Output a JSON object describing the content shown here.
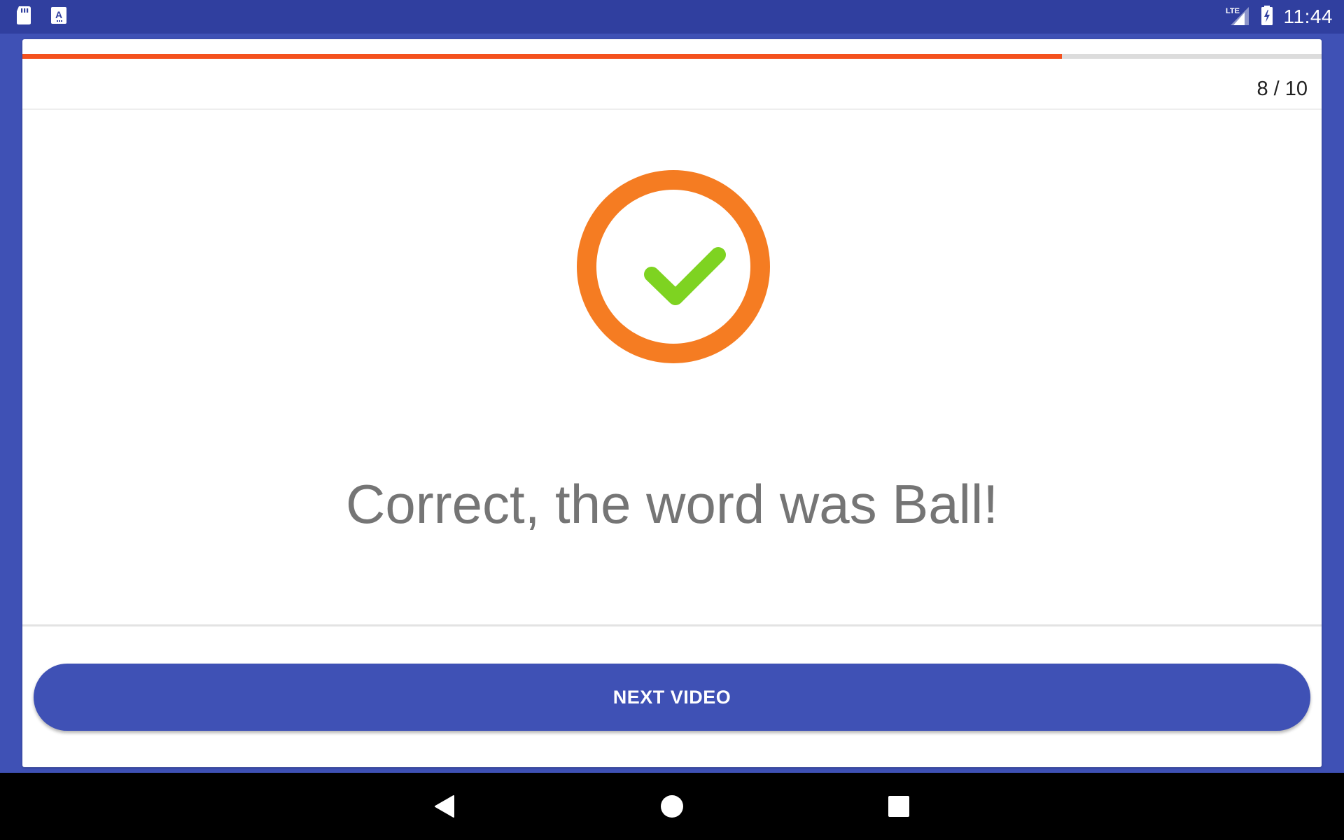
{
  "status_bar": {
    "left_icons": [
      "sd-card-icon",
      "keyboard-a-icon"
    ],
    "network": "LTE",
    "right_icons": [
      "signal-icon",
      "battery-charging-icon"
    ],
    "time": "11:44"
  },
  "quiz": {
    "progress_fraction": 0.8,
    "counter": "8 / 10",
    "result_icon": "check-circle-icon",
    "message": "Correct, the word was Ball!",
    "next_button_label": "NEXT VIDEO"
  },
  "navigation": {
    "buttons": [
      "back-icon",
      "home-icon",
      "recents-icon"
    ]
  },
  "colors": {
    "primary": "#3f51b5",
    "primary_dark": "#303f9f",
    "progress": "#f4511e",
    "ring": "#f57c22",
    "check": "#7ed321",
    "message_text": "#757575"
  }
}
